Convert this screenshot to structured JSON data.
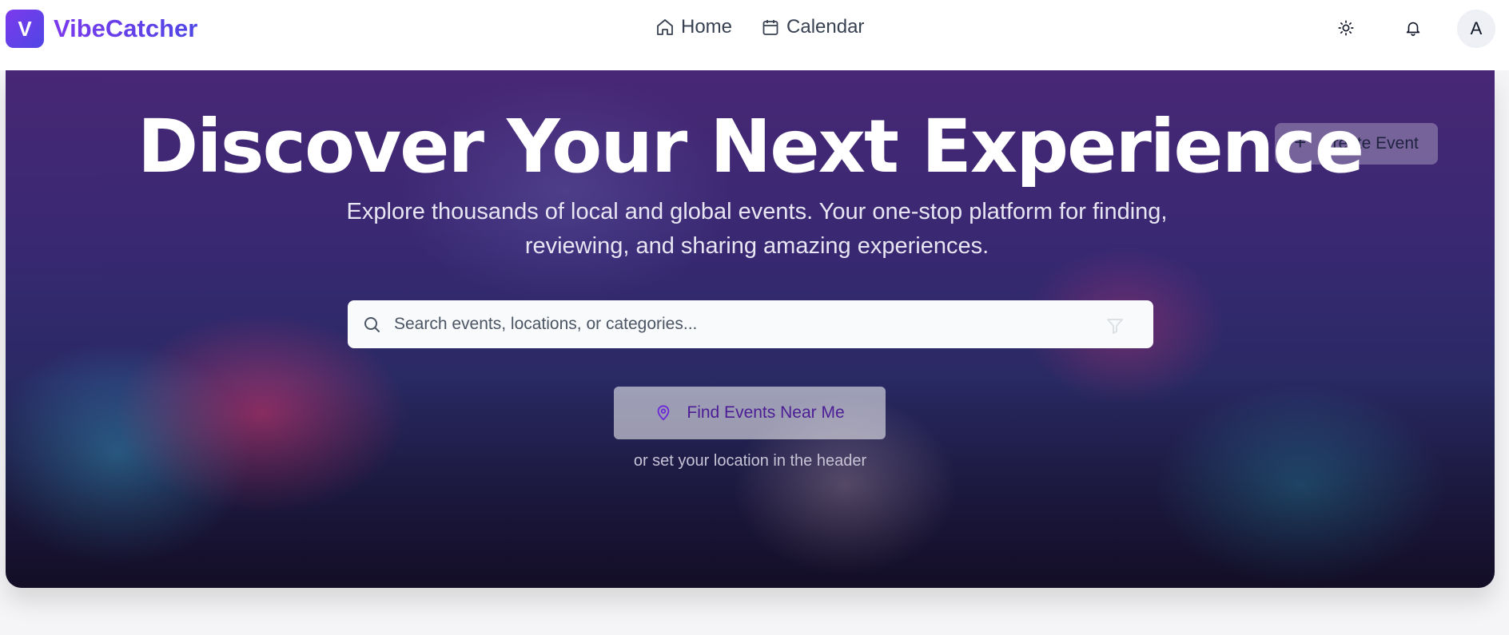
{
  "brand": {
    "logo_letter": "V",
    "name": "VibeCatcher"
  },
  "nav": [
    {
      "label": "Home",
      "icon": "home-icon"
    },
    {
      "label": "Calendar",
      "icon": "calendar-icon"
    }
  ],
  "header_actions": {
    "theme_icon": "sun-icon",
    "notifications_icon": "bell-icon",
    "avatar_initial": "A"
  },
  "hero": {
    "title": "Discover Your Next Experience",
    "subtitle": "Explore thousands of local and global events. Your one-stop platform for finding, reviewing, and sharing amazing experiences.",
    "create_event_label": "Create Event",
    "search_placeholder": "Search events, locations, or categories...",
    "near_me_label": "Find Events Near Me",
    "near_me_hint": "or set your location in the header"
  },
  "colors": {
    "brand_start": "#7c3aed",
    "brand_end": "#4f46e5",
    "near_me_text": "#4c1d95"
  }
}
